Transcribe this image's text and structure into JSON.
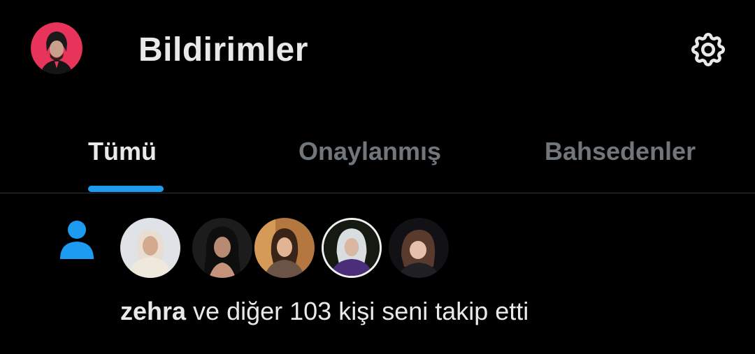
{
  "header": {
    "title": "Bildirimler",
    "profile_avatar_icon": "profile-avatar",
    "settings_icon": "gear-icon"
  },
  "tabs": [
    {
      "label": "Tümü",
      "active": true
    },
    {
      "label": "Onaylanmış",
      "active": false
    },
    {
      "label": "Bahsedenler",
      "active": false
    }
  ],
  "colors": {
    "background": "#000000",
    "text_primary": "#e7e9ea",
    "text_secondary": "#71767b",
    "accent": "#1d9bf0",
    "profile_ring": "#e8345a"
  },
  "notification": {
    "type_icon": "person-icon",
    "follower_avatars": [
      "follower-avatar-1",
      "follower-avatar-2",
      "follower-avatar-3",
      "follower-avatar-4",
      "follower-avatar-5"
    ],
    "username": "zehra",
    "message": " ve diğer 103 kişi seni takip etti"
  }
}
